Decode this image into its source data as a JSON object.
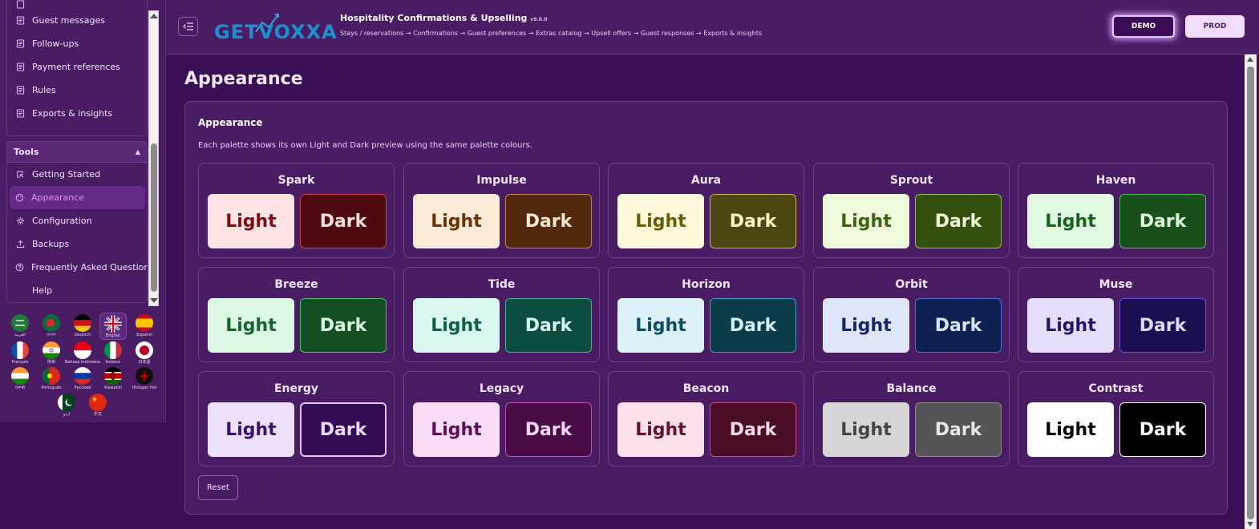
{
  "sidebar": {
    "items": [
      {
        "label": "Guest messages",
        "icon": "document-icon"
      },
      {
        "label": "Follow-ups",
        "icon": "document-icon"
      },
      {
        "label": "Payment references",
        "icon": "document-icon"
      },
      {
        "label": "Rules",
        "icon": "document-icon"
      },
      {
        "label": "Exports & insights",
        "icon": "document-icon"
      }
    ],
    "tools": {
      "header": "Tools",
      "items": [
        {
          "label": "Getting Started",
          "icon": "start-icon"
        },
        {
          "label": "Appearance",
          "icon": "palette-icon"
        },
        {
          "label": "Configuration",
          "icon": "gear-icon"
        },
        {
          "label": "Backups",
          "icon": "upload-icon"
        },
        {
          "label": "Frequently Asked Questions",
          "icon": "question-icon"
        },
        {
          "label": "Help",
          "icon": ""
        }
      ]
    },
    "languages": [
      {
        "label": "العربية"
      },
      {
        "label": "বাংলা"
      },
      {
        "label": "Deutsch"
      },
      {
        "label": "English"
      },
      {
        "label": "Español"
      },
      {
        "label": "Français"
      },
      {
        "label": "हिन्दी"
      },
      {
        "label": "Bahasa Indonesia"
      },
      {
        "label": "Italiano"
      },
      {
        "label": "日本語"
      },
      {
        "label": "ਪੰਜਾਬੀ"
      },
      {
        "label": "Português"
      },
      {
        "label": "Русский"
      },
      {
        "label": "Kiswahili"
      },
      {
        "label": "tlhIngan Hol"
      },
      {
        "label": "اردو"
      },
      {
        "label": "中文"
      }
    ]
  },
  "header": {
    "logo_text": "GETVOXXA",
    "title": "Hospitality Confirmations & Upselling",
    "version": "v9.0.0",
    "subtitle": "Stays / reservations → Confirmations → Guest preferences → Extras catalog → Upsell offers → Guest responses → Exports & insights",
    "demo_label": "DEMO",
    "prod_label": "PROD"
  },
  "page": {
    "title": "Appearance",
    "card_title": "Appearance",
    "card_desc": "Each palette shows its own Light and Dark preview using the same palette colours.",
    "reset_label": "Reset"
  },
  "palettes": [
    {
      "name": "Spark",
      "light_label": "Light",
      "dark_label": "Dark",
      "light_bg": "#fde3e3",
      "light_fg": "#7a0e12",
      "dark_bg": "#4f0a0f",
      "dark_fg": "#ffdede",
      "dark_border": "#c94545"
    },
    {
      "name": "Impulse",
      "light_label": "Light",
      "dark_label": "Dark",
      "light_bg": "#fdebd9",
      "light_fg": "#6b3208",
      "dark_bg": "#52290d",
      "dark_fg": "#ffe9d4",
      "dark_border": "#c7853f"
    },
    {
      "name": "Aura",
      "light_label": "Light",
      "dark_label": "Dark",
      "light_bg": "#fdf8da",
      "light_fg": "#6b5d08",
      "dark_bg": "#4c4610",
      "dark_fg": "#fff6cc",
      "dark_border": "#c7b746"
    },
    {
      "name": "Sprout",
      "light_label": "Light",
      "dark_label": "Dark",
      "light_bg": "#eff9dc",
      "light_fg": "#3d6212",
      "dark_bg": "#34500f",
      "dark_fg": "#f1ffd8",
      "dark_border": "#8fbf4d"
    },
    {
      "name": "Haven",
      "light_label": "Light",
      "dark_label": "Dark",
      "light_bg": "#e1f8e2",
      "light_fg": "#16631b",
      "dark_bg": "#17501a",
      "dark_fg": "#ddffe0",
      "dark_border": "#4fbf5a"
    },
    {
      "name": "Breeze",
      "light_label": "Light",
      "dark_label": "Dark",
      "light_bg": "#def8e6",
      "light_fg": "#13662f",
      "dark_bg": "#144f24",
      "dark_fg": "#ddffe6",
      "dark_border": "#4bbf6c"
    },
    {
      "name": "Tide",
      "light_label": "Light",
      "dark_label": "Dark",
      "light_bg": "#d9f7ef",
      "light_fg": "#0d5f4c",
      "dark_bg": "#0c4d40",
      "dark_fg": "#d6fff4",
      "dark_border": "#3fb79a"
    },
    {
      "name": "Horizon",
      "light_label": "Light",
      "dark_label": "Dark",
      "light_bg": "#dcf2f8",
      "light_fg": "#0d4e63",
      "dark_bg": "#0c3c4a",
      "dark_fg": "#d6f6ff",
      "dark_border": "#3f9fbf"
    },
    {
      "name": "Orbit",
      "light_label": "Light",
      "dark_label": "Dark",
      "light_bg": "#e0e6fa",
      "light_fg": "#13286c",
      "dark_bg": "#0f2152",
      "dark_fg": "#dbe4ff",
      "dark_border": "#4f6fcf"
    },
    {
      "name": "Muse",
      "light_label": "Light",
      "dark_label": "Dark",
      "light_bg": "#e5defa",
      "light_fg": "#27136c",
      "dark_bg": "#1b0f52",
      "dark_fg": "#e1d8ff",
      "dark_border": "#654fcf"
    },
    {
      "name": "Energy",
      "light_label": "Light",
      "dark_label": "Dark",
      "light_bg": "#ede0fb",
      "light_fg": "#3c136b",
      "dark_bg": "#320c55",
      "dark_fg": "#eedcff",
      "dark_border": "#e6c6ff"
    },
    {
      "name": "Legacy",
      "light_label": "Light",
      "dark_label": "Dark",
      "light_bg": "#f9dcf5",
      "light_fg": "#5e0f58",
      "dark_bg": "#4a0c47",
      "dark_fg": "#ffd8fb",
      "dark_border": "#bf4fb7"
    },
    {
      "name": "Beacon",
      "light_label": "Light",
      "dark_label": "Dark",
      "light_bg": "#fae0ea",
      "light_fg": "#62112f",
      "dark_bg": "#4b0d26",
      "dark_fg": "#ffdbe8",
      "dark_border": "#c24f7a"
    },
    {
      "name": "Balance",
      "light_label": "Light",
      "dark_label": "Dark",
      "light_bg": "#d6d6d6",
      "light_fg": "#444444",
      "dark_bg": "#555555",
      "dark_fg": "#e6e6e6",
      "dark_border": "#8a8a8a"
    },
    {
      "name": "Contrast",
      "light_label": "Light",
      "dark_label": "Dark",
      "light_bg": "#ffffff",
      "light_fg": "#000000",
      "dark_bg": "#000000",
      "dark_fg": "#ffffff",
      "dark_border": "#ffffff"
    }
  ]
}
